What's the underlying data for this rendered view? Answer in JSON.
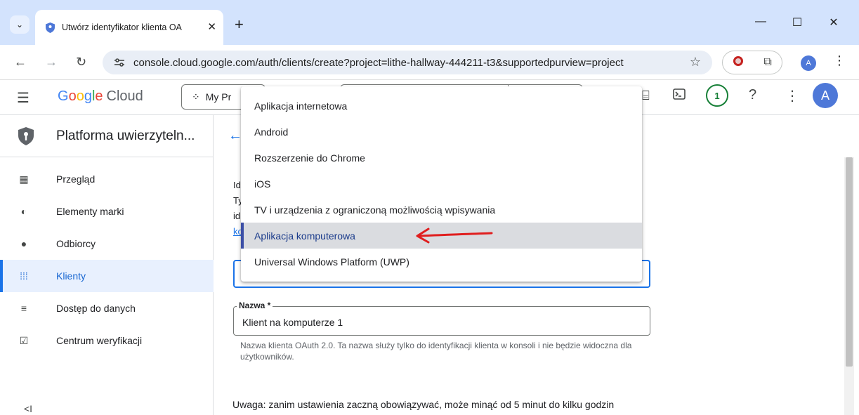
{
  "browser": {
    "tab_title": "Utwórz identyfikator klienta OA",
    "url": "console.cloud.google.com/auth/clients/create?project=lithe-hallway-444211-t3&supportedpurview=project",
    "profile_initial": "A"
  },
  "header": {
    "logo_parts": [
      "G",
      "o",
      "o",
      "g",
      "l",
      "e"
    ],
    "logo_cloud": "Cloud",
    "project_label": "My Pr",
    "notification_count": "1",
    "avatar_initial": "A"
  },
  "sidebar": {
    "title": "Platforma uwierzyteln...",
    "items": [
      {
        "label": "Przegląd",
        "icon": "dashboard-icon"
      },
      {
        "label": "Elementy marki",
        "icon": "palette-icon"
      },
      {
        "label": "Odbiorcy",
        "icon": "person-icon"
      },
      {
        "label": "Klienty",
        "icon": "grid-icon",
        "active": true
      },
      {
        "label": "Dostęp do danych",
        "icon": "data-settings-icon"
      },
      {
        "label": "Centrum weryfikacji",
        "icon": "verify-icon"
      }
    ],
    "collapse_label": "<I"
  },
  "main": {
    "snippet_lines": [
      "Id",
      "Ty",
      "id",
      "ko"
    ],
    "name_field": {
      "label": "Nazwa *",
      "value": "Klient na komputerze 1"
    },
    "helper_text": "Nazwa klienta OAuth 2.0. Ta nazwa służy tylko do identyfikacji klienta w konsoli i nie będzie widoczna dla użytkowników.",
    "warning": "Uwaga: zanim ustawienia zaczną obowiązywać, może minąć od 5 minut do kilku godzin"
  },
  "dropdown": {
    "options": [
      "Aplikacja internetowa",
      "Android",
      "Rozszerzenie do Chrome",
      "iOS",
      "TV i urządzenia z ograniczoną możliwością wpisywania",
      "Aplikacja komputerowa",
      "Universal Windows Platform (UWP)"
    ],
    "selected_index": 5
  },
  "colors": {
    "accent": "#1a73e8",
    "annotation_arrow": "#e01e1e",
    "tabstrip": "#d3e3fd"
  }
}
